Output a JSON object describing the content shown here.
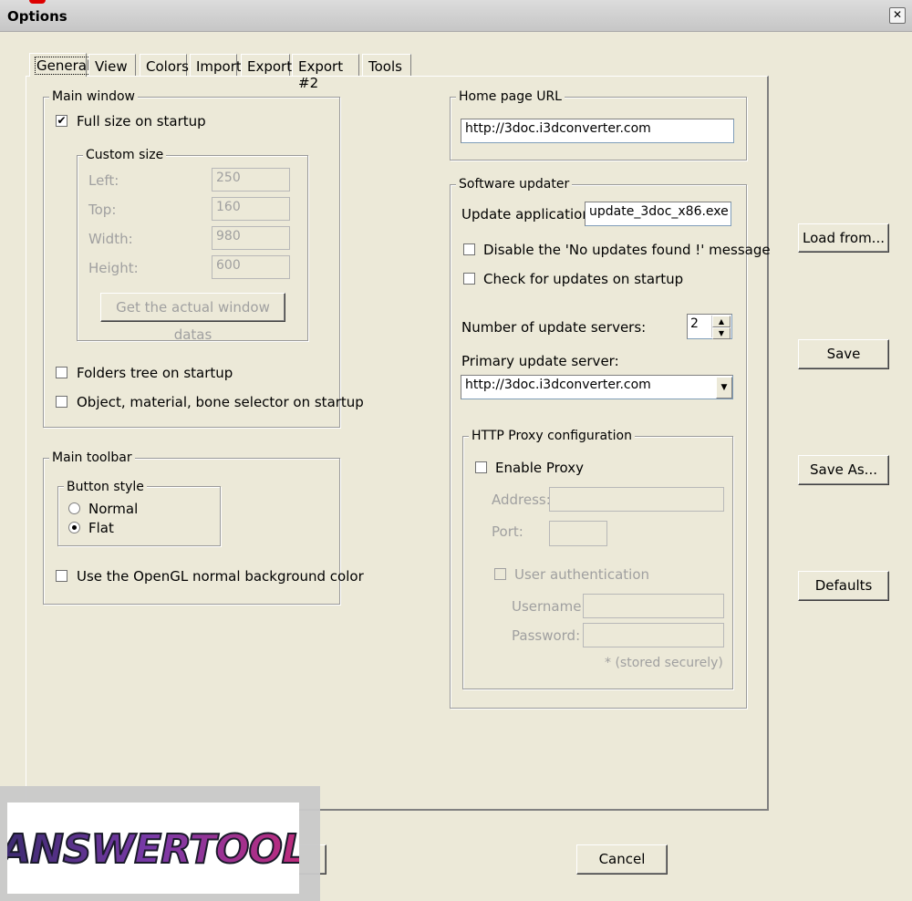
{
  "window": {
    "title": "Options",
    "close_glyph": "✕"
  },
  "tabs": [
    "General",
    "View",
    "Colors",
    "Import",
    "Export",
    "Export #2",
    "Tools"
  ],
  "main_window": {
    "legend": "Main window",
    "full_size_label": "Full size on startup",
    "full_size_checked": true,
    "custom_size": {
      "legend": "Custom size",
      "left_label": "Left:",
      "left_value": "250",
      "top_label": "Top:",
      "top_value": "160",
      "width_label": "Width:",
      "width_value": "980",
      "height_label": "Height:",
      "height_value": "600",
      "get_button": "Get the actual window datas"
    },
    "folders_tree_label": "Folders tree on startup",
    "selector_label": "Object, material, bone selector on startup"
  },
  "main_toolbar": {
    "legend": "Main toolbar",
    "button_style_legend": "Button style",
    "normal_label": "Normal",
    "flat_label": "Flat",
    "selected": "Flat",
    "opengl_label": "Use the OpenGL normal background color"
  },
  "home_page": {
    "legend": "Home page URL",
    "url": "http://3doc.i3dconverter.com"
  },
  "software_updater": {
    "legend": "Software updater",
    "update_app_label": "Update application:",
    "update_app_value": "update_3doc_x86.exe",
    "disable_msg_label": "Disable the 'No updates found !' message",
    "check_startup_label": "Check for updates on startup",
    "num_servers_label": "Number of update servers:",
    "num_servers_value": "2",
    "primary_label": "Primary update server:",
    "primary_value": "http://3doc.i3dconverter.com"
  },
  "proxy": {
    "legend": "HTTP Proxy configuration",
    "enable_label": "Enable Proxy",
    "address_label": "Address:",
    "port_label": "Port:",
    "user_auth_label": "User authentication",
    "username_label": "Username:",
    "password_label": "Password: *",
    "stored_note": "* (stored securely)"
  },
  "side_buttons": {
    "load": "Load from...",
    "save": "Save",
    "save_as": "Save As...",
    "defaults": "Defaults"
  },
  "bottom": {
    "cancel": "Cancel"
  },
  "watermark": {
    "text": "ANSWERTOOL"
  }
}
